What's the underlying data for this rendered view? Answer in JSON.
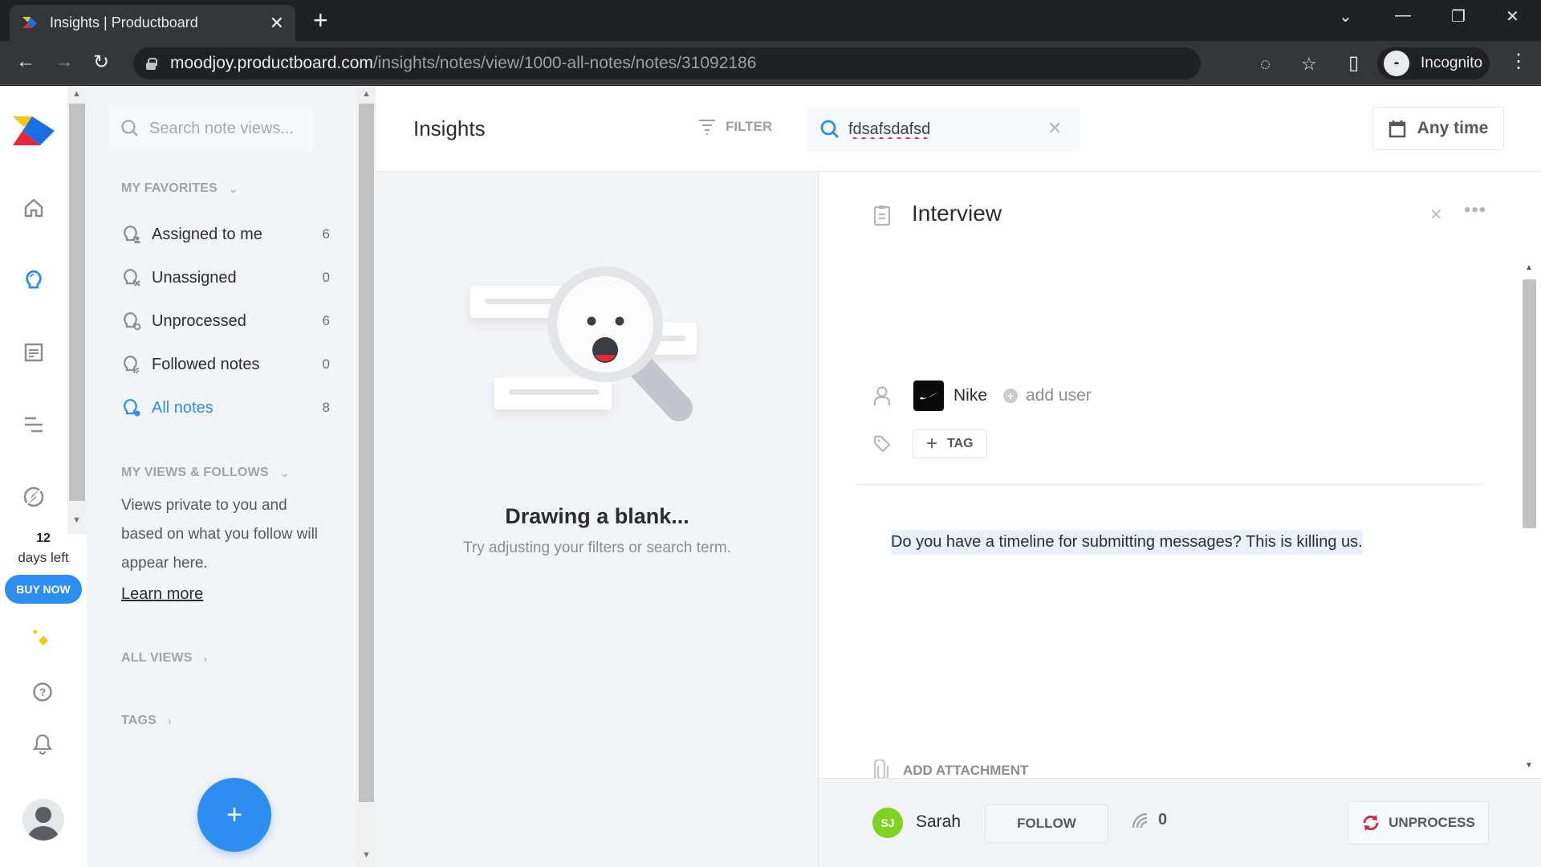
{
  "browser": {
    "tab_title": "Insights | Productboard",
    "url_host": "moodjoy.productboard.com",
    "url_path": "/insights/notes/view/1000-all-notes/notes/31092186",
    "profile_label": "Incognito"
  },
  "rail": {
    "items": [
      "home",
      "insights",
      "notes",
      "roadmap",
      "portal"
    ],
    "trial_days": "12",
    "trial_days_label": "days left",
    "buy_now": "BUY NOW"
  },
  "sidebar": {
    "search_placeholder": "Search note views...",
    "favorites_heading": "MY FAVORITES",
    "favorites": [
      {
        "label": "Assigned to me",
        "count": "6"
      },
      {
        "label": "Unassigned",
        "count": "0"
      },
      {
        "label": "Unprocessed",
        "count": "6"
      },
      {
        "label": "Followed notes",
        "count": "0"
      },
      {
        "label": "All notes",
        "count": "8",
        "active": true
      }
    ],
    "views_heading": "MY VIEWS & FOLLOWS",
    "views_note": "Views private to you and based on what you follow will appear here.",
    "learn_more": "Learn more",
    "all_views": "ALL VIEWS",
    "tags": "TAGS",
    "add_button": "+"
  },
  "header": {
    "title": "Insights",
    "filter_label": "FILTER",
    "search_value": "fdsafsdafsd",
    "date_filter": "Any time"
  },
  "list": {
    "empty_title": "Drawing a blank...",
    "empty_subtitle": "Try adjusting your filters or search term."
  },
  "note": {
    "type": "Interview",
    "company": "Nike",
    "add_user": "add user",
    "tag_button": "TAG",
    "content": "Do you have a timeline for submitting messages? This is killing us.",
    "add_attachment": "ADD ATTACHMENT",
    "owner_initials": "SJ",
    "owner_name": "Sarah",
    "follow_button": "FOLLOW",
    "followers_count": "0",
    "unprocess_button": "UNPROCESS"
  },
  "colors": {
    "accent": "#2d8ef0",
    "owner_avatar": "#7ed321",
    "unprocess_icon": "#d0243c"
  }
}
